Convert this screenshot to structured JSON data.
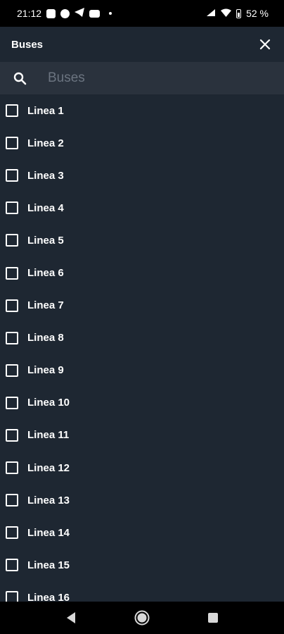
{
  "status_bar": {
    "time": "21:12",
    "battery_text": "52 %",
    "icons_left": [
      "notification-icon",
      "messenger-icon",
      "telegram-icon",
      "youtube-icon"
    ],
    "icons_right": [
      "signal-icon",
      "wifi-icon",
      "battery-icon"
    ]
  },
  "header": {
    "title": "Buses",
    "close_icon": "close-icon"
  },
  "search": {
    "placeholder": "Buses",
    "value": ""
  },
  "list": {
    "items": [
      {
        "label": "Linea 1",
        "checked": false
      },
      {
        "label": "Linea 2",
        "checked": false
      },
      {
        "label": "Linea 3",
        "checked": false
      },
      {
        "label": "Linea 4",
        "checked": false
      },
      {
        "label": "Linea 5",
        "checked": false
      },
      {
        "label": "Linea 6",
        "checked": false
      },
      {
        "label": "Linea 7",
        "checked": false
      },
      {
        "label": "Linea 8",
        "checked": false
      },
      {
        "label": "Linea 9",
        "checked": false
      },
      {
        "label": "Linea 10",
        "checked": false
      },
      {
        "label": "Linea 11",
        "checked": false
      },
      {
        "label": "Linea 12",
        "checked": false
      },
      {
        "label": "Linea 13",
        "checked": false
      },
      {
        "label": "Linea 14",
        "checked": false
      },
      {
        "label": "Linea 15",
        "checked": false
      },
      {
        "label": "Linea 16",
        "checked": false
      }
    ]
  },
  "nav_bar": {
    "buttons": [
      "back-icon",
      "home-icon",
      "recents-icon"
    ]
  },
  "colors": {
    "background": "#1e2732",
    "search_background": "#2a323d",
    "text": "#ffffff",
    "placeholder": "#6b7480"
  }
}
